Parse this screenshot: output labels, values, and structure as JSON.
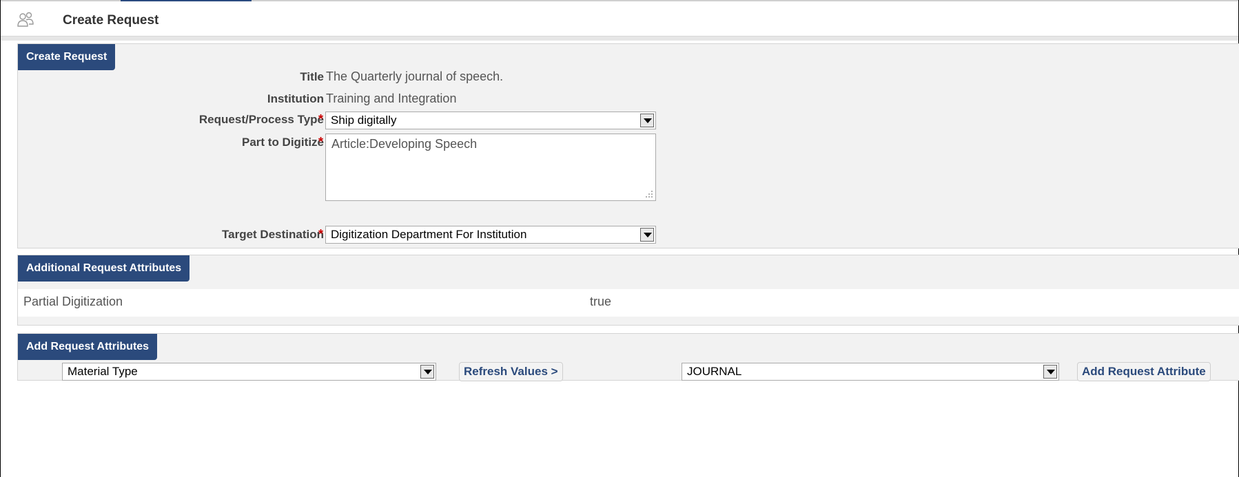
{
  "header": {
    "title": "Create Request",
    "icon": "people-icon"
  },
  "create_request": {
    "tab_label": "Create Request",
    "fields": {
      "title_label": "Title",
      "title_value": "The Quarterly journal of speech.",
      "institution_label": "Institution",
      "institution_value": "Training and Integration",
      "request_type_label": "Request/Process Type",
      "request_type_value": "Ship digitally",
      "part_label": "Part to Digitize",
      "part_value": "Article:Developing Speech",
      "target_label": "Target Destination",
      "target_value": "Digitization Department For Institution",
      "required_mark": "*"
    }
  },
  "additional_attributes": {
    "tab_label": "Additional Request Attributes",
    "rows": [
      {
        "name": "Partial Digitization",
        "value": "true"
      }
    ]
  },
  "add_attributes": {
    "tab_label": "Add Request Attributes",
    "attribute_select": "Material Type",
    "refresh_button": "Refresh Values >",
    "value_select": "JOURNAL",
    "add_button": "Add Request Attribute"
  },
  "colors": {
    "tab_bg": "#2b4a7c",
    "required": "#cc0000",
    "panel_bg": "#f2f2f2"
  }
}
